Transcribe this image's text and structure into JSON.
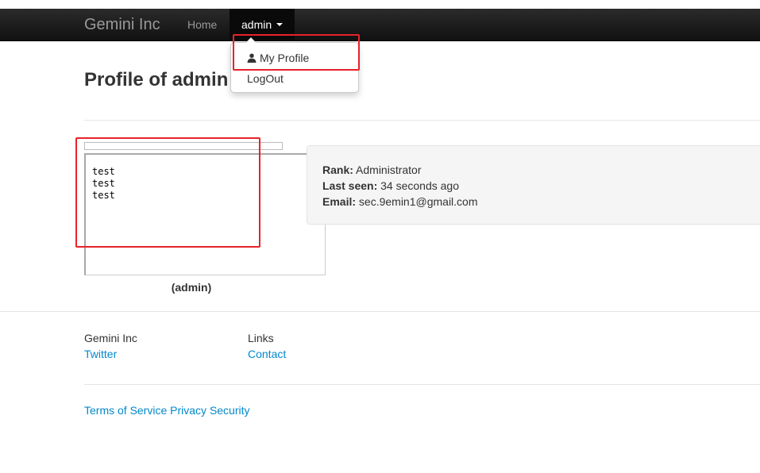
{
  "navbar": {
    "brand": "Gemini Inc",
    "home": "Home",
    "user_menu": "admin",
    "dropdown": {
      "my_profile": "My Profile",
      "logout": "LogOut"
    }
  },
  "page": {
    "title": "Profile of admin"
  },
  "profile": {
    "avatar_text": "test\ntest\ntest",
    "username": "(admin)",
    "rank_label": "Rank:",
    "rank_value": "Administrator",
    "last_seen_label": "Last seen:",
    "last_seen_value": "34 seconds ago",
    "email_label": "Email:",
    "email_value": "sec.9emin1@gmail.com"
  },
  "footer": {
    "col1_heading": "Gemini Inc",
    "col1_link": "Twitter",
    "col2_heading": "Links",
    "col2_link": "Contact",
    "legal": [
      "Terms of Service",
      "Privacy",
      "Security"
    ]
  },
  "colors": {
    "highlight": "#e8222a",
    "link": "#0088cc",
    "navbar": "#1b1b1b"
  },
  "icons": {
    "profile_item": "user-icon",
    "user_menu": "caret-down-icon"
  }
}
